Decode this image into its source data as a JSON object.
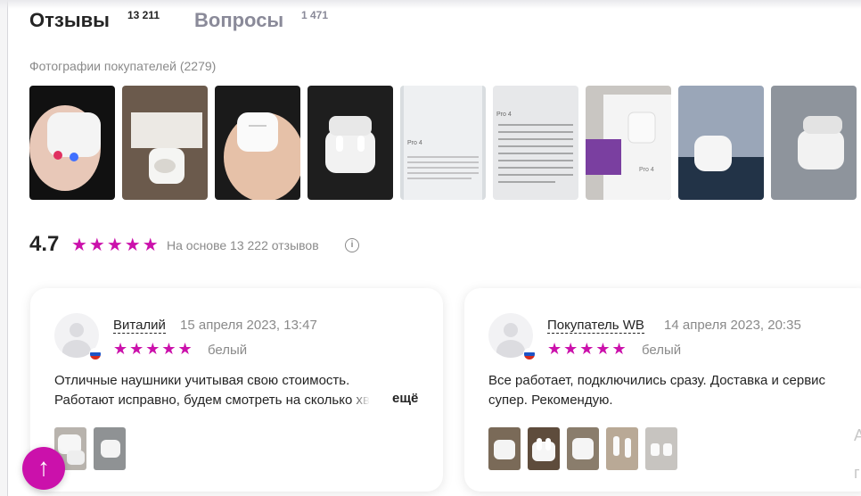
{
  "tabs": [
    {
      "label": "Отзывы",
      "count": "13 211"
    },
    {
      "label": "Вопросы",
      "count": "1 471"
    }
  ],
  "photos_section": {
    "title": "Фотографии покупателей (2279)"
  },
  "summary": {
    "rating": "4.7",
    "stars": "★★★★★",
    "note": "На основе 13 222 отзывов",
    "info_icon": "i"
  },
  "reviews": [
    {
      "author": "Виталий",
      "date": "15 апреля 2023, 13:47",
      "stars": "★★★★★",
      "variant": "белый",
      "text_line1": "Отличные наушники учитывая свою стоимость.",
      "text_line2": "Работают исправно, будем смотреть на сколько",
      "text_line2_fade": " хв",
      "more": "ещё"
    },
    {
      "author": "Покупатель WB",
      "date": "14 апреля 2023, 20:35",
      "stars": "★★★★★",
      "variant": "белый",
      "text_line1": "Все работает, подключились сразу. Доставка и сервис",
      "text_line2": "супер. Рекомендую."
    }
  ],
  "scroll_top": {
    "icon": "arrow-up-icon",
    "glyph": "↑"
  },
  "edge_text": {
    "top": "A",
    "bottom": "г"
  },
  "colors": {
    "accent": "#cb11ab",
    "muted": "#8a8a8a",
    "text": "#242424"
  }
}
